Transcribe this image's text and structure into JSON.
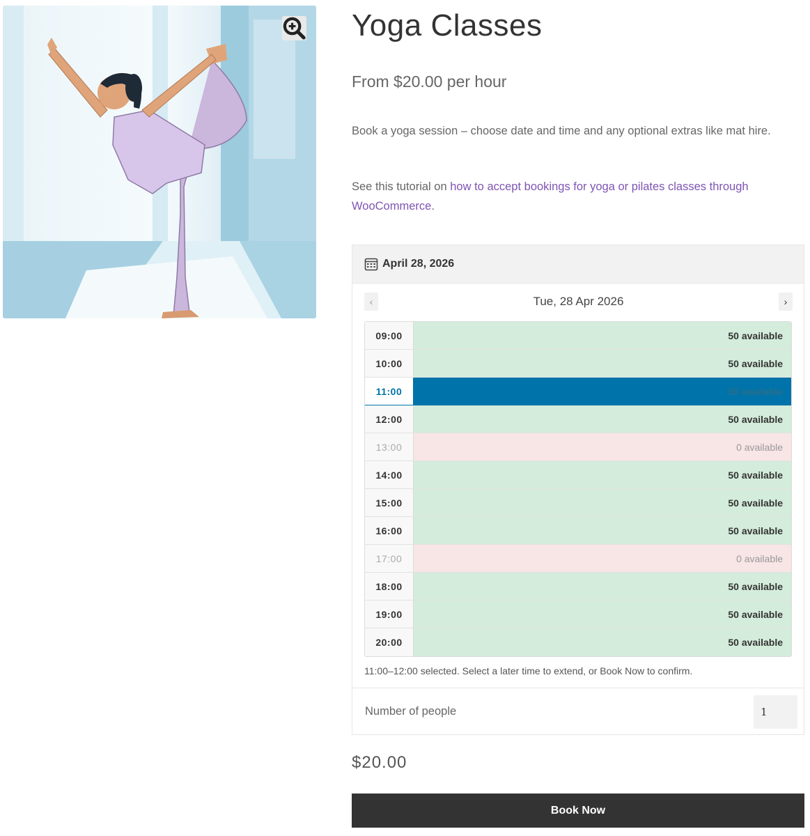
{
  "product": {
    "title": "Yoga Classes",
    "price_from": "From $20.00 per hour",
    "description": "Book a yoga session – choose date and time and any optional extras like mat hire.",
    "tutorial_prefix": "See this tutorial on ",
    "tutorial_link": "how to accept bookings for yoga or pilates classes through WooCommerce",
    "tutorial_suffix": "."
  },
  "gallery": {
    "zoom_icon": "magnifier-plus-icon"
  },
  "booking": {
    "selected_date": "April 28, 2026",
    "calendar_icon": "calendar-icon",
    "day_label": "Tue, 28 Apr 2026",
    "prev_label": "‹",
    "next_label": "›",
    "slots": [
      {
        "time": "09:00",
        "availability": "50 available",
        "state": "available"
      },
      {
        "time": "10:00",
        "availability": "50 available",
        "state": "available"
      },
      {
        "time": "11:00",
        "availability": "50 available",
        "state": "selected"
      },
      {
        "time": "12:00",
        "availability": "50 available",
        "state": "available"
      },
      {
        "time": "13:00",
        "availability": "0 available",
        "state": "full"
      },
      {
        "time": "14:00",
        "availability": "50 available",
        "state": "available"
      },
      {
        "time": "15:00",
        "availability": "50 available",
        "state": "available"
      },
      {
        "time": "16:00",
        "availability": "50 available",
        "state": "available"
      },
      {
        "time": "17:00",
        "availability": "0 available",
        "state": "full"
      },
      {
        "time": "18:00",
        "availability": "50 available",
        "state": "available"
      },
      {
        "time": "19:00",
        "availability": "50 available",
        "state": "available"
      },
      {
        "time": "20:00",
        "availability": "50 available",
        "state": "available"
      }
    ],
    "selection_message": "11:00–12:00 selected. Select a later time to extend, or Book Now to confirm.",
    "people_label": "Number of people",
    "people_value": "1"
  },
  "total": "$20.00",
  "book_button": "Book Now",
  "colors": {
    "link": "#7f54b3",
    "available": "#d4ecdb",
    "full": "#f8e5e6",
    "selected": "#0073aa",
    "button": "#333333"
  }
}
